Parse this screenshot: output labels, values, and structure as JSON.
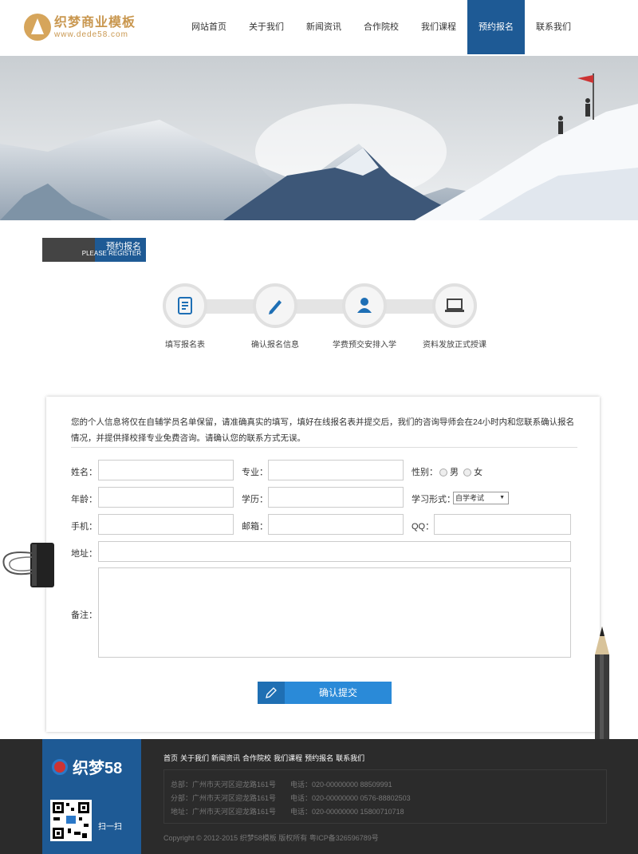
{
  "header": {
    "logo_title": "织梦商业模板",
    "logo_url": "www.dede58.com",
    "nav": [
      {
        "label": "网站首页",
        "active": false
      },
      {
        "label": "关于我们",
        "active": false
      },
      {
        "label": "新闻资讯",
        "active": false
      },
      {
        "label": "合作院校",
        "active": false
      },
      {
        "label": "我们课程",
        "active": false
      },
      {
        "label": "预约报名",
        "active": true
      },
      {
        "label": "联系我们",
        "active": false
      }
    ]
  },
  "section": {
    "title_cn": "预约报名",
    "title_en": "PLEASE REGISTER"
  },
  "steps": [
    {
      "label": "填写报名表",
      "icon": "form-icon"
    },
    {
      "label": "确认报名信息",
      "icon": "pen-icon"
    },
    {
      "label": "学费预交安排入学",
      "icon": "person-icon"
    },
    {
      "label": "资料发放正式授课",
      "icon": "laptop-icon"
    }
  ],
  "form": {
    "intro": "您的个人信息将仅在自辅学员名单保留，请准确真实的填写，填好在线报名表并提交后，我们的咨询导师会在24小时内和您联系确认报名情况，并提供择校择专业免费咨询。请确认您的联系方式无误。",
    "name_label": "姓名：",
    "major_label": "专业：",
    "gender_label": "性别：",
    "gender_male": "男",
    "gender_female": "女",
    "age_label": "年龄：",
    "edu_label": "学历：",
    "study_label": "学习形式：",
    "study_selected": "自学考试",
    "phone_label": "手机：",
    "email_label": "邮箱：",
    "qq_label": "QQ：",
    "address_label": "地址：",
    "remark_label": "备注：",
    "submit_label": "确认提交"
  },
  "footer": {
    "logo_text": "织梦58",
    "scan_label": "扫一扫",
    "links": [
      "首页",
      "关于我们",
      "新闻资讯",
      "合作院校",
      "我们课程",
      "预约报名",
      "联系我们"
    ],
    "rows": [
      {
        "addr": "总部：广州市天河区迎龙路161号",
        "phone": "电话：020-00000000 88509991"
      },
      {
        "addr": "分部：广州市天河区迎龙路161号",
        "phone": "电话：020-00000000 0576-88802503"
      },
      {
        "addr": "地址：广州市天河区迎龙路161号",
        "phone": "电话：020-00000000 15800710718"
      }
    ],
    "copyright": "Copyright © 2012-2015 织梦58模板 版权所有 粤ICP备326596789号"
  }
}
